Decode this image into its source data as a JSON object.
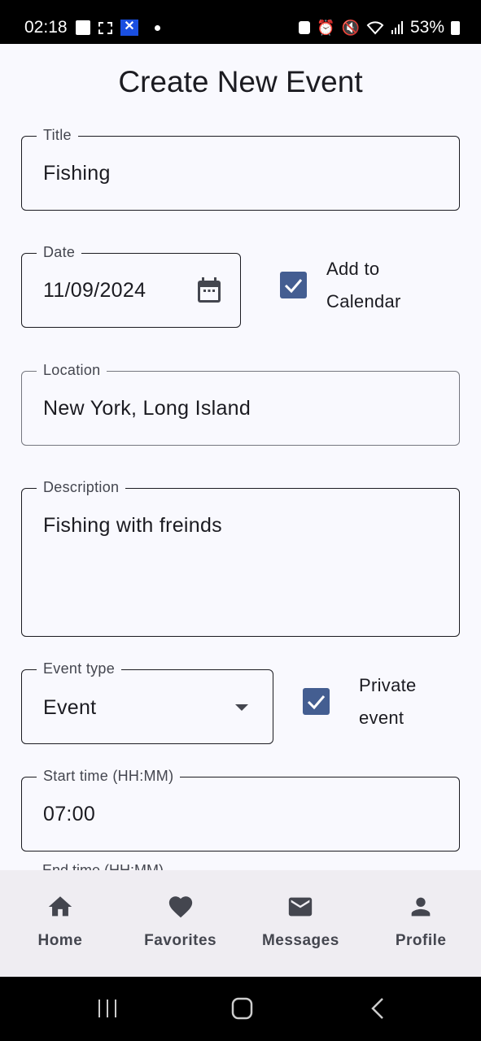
{
  "status_bar": {
    "time": "02:18",
    "left_icons": [
      "gallery-icon",
      "screenshot-icon",
      "app-x-icon",
      "notification-dot"
    ],
    "right_icons": [
      "battery-saver-icon",
      "alarm-icon",
      "mute-icon",
      "wifi-icon",
      "signal-icon"
    ],
    "battery": "53%"
  },
  "page": {
    "title": "Create New Event"
  },
  "form": {
    "title": {
      "label": "Title",
      "value": "Fishing"
    },
    "date": {
      "label": "Date",
      "value": "11/09/2024",
      "icon": "calendar-icon"
    },
    "add_to_calendar": {
      "line1": "Add to",
      "line2": "Calendar",
      "checked": true
    },
    "location": {
      "label": "Location",
      "value": "New York, Long Island"
    },
    "description": {
      "label": "Description",
      "value": "Fishing with freinds"
    },
    "event_type": {
      "label": "Event type",
      "value": "Event",
      "icon": "dropdown-arrow-icon"
    },
    "private_event": {
      "line1": "Private",
      "line2": "event",
      "checked": true
    },
    "start_time": {
      "label": "Start time (HH:MM)",
      "value": "07:00"
    },
    "end_time": {
      "label": "End time (HH:MM)"
    }
  },
  "bottom_nav": {
    "items": [
      {
        "label": "Home",
        "icon": "home-icon"
      },
      {
        "label": "Favorites",
        "icon": "heart-icon"
      },
      {
        "label": "Messages",
        "icon": "mail-icon"
      },
      {
        "label": "Profile",
        "icon": "person-icon"
      }
    ]
  },
  "system_nav": {
    "buttons": [
      "recent-apps",
      "home",
      "back"
    ]
  },
  "colors": {
    "accent": "#445e91",
    "background": "#f9f9fe",
    "navbar": "#efedf2"
  }
}
